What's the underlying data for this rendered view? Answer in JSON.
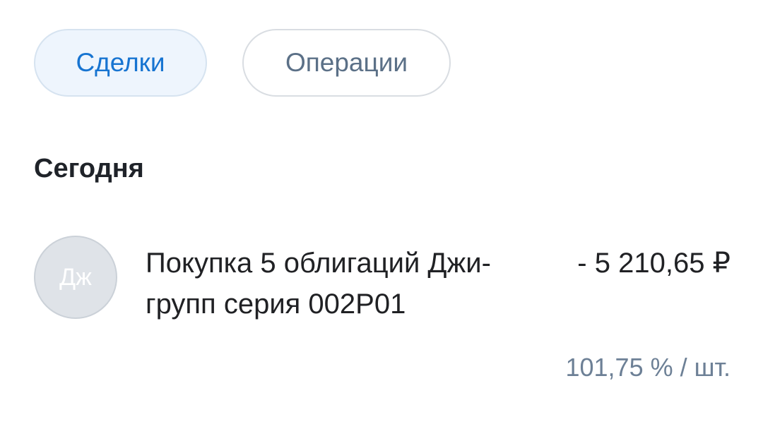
{
  "tabs": [
    {
      "label": "Сделки",
      "active": true
    },
    {
      "label": "Операции",
      "active": false
    }
  ],
  "section": {
    "title": "Сегодня"
  },
  "operations": [
    {
      "avatar_initials": "Дж",
      "title": "Покупка 5 облигаций Джи-групп серия 002Р01",
      "amount": "- 5 210,65 ₽",
      "price": "101,75 % / шт."
    }
  ],
  "colors": {
    "accent": "#1774d1",
    "tab_active_bg": "#eef5fd",
    "secondary_text": "#6d8096",
    "avatar_bg": "#dfe3e8"
  }
}
